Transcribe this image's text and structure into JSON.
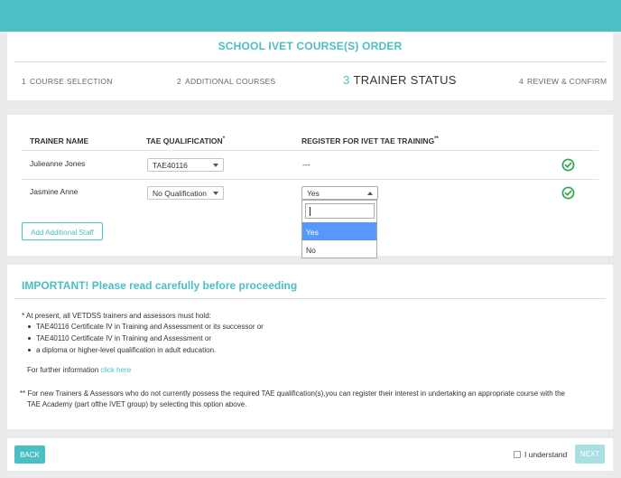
{
  "header": {
    "title": "SCHOOL IVET COURSE(S) ORDER"
  },
  "steps": [
    {
      "num": "1",
      "label": "COURSE SELECTION"
    },
    {
      "num": "2",
      "label": "ADDITIONAL COURSES"
    },
    {
      "num": "3",
      "label": "TRAINER STATUS"
    },
    {
      "num": "4",
      "label": "REVIEW & CONFIRM"
    }
  ],
  "active_step": 3,
  "table": {
    "headers": {
      "name": "TRAINER NAME",
      "tae": "TAE QUALIFICATION",
      "tae_mark": "*",
      "register": "REGISTER FOR IVET TAE TRAINING",
      "register_mark": "**"
    },
    "rows": [
      {
        "name": "Julieanne Jones",
        "qualification": "TAE40116",
        "register": "---"
      },
      {
        "name": "Jasmine Anne",
        "qualification": "No Qualification",
        "register": "Yes"
      }
    ],
    "add_staff_label": "Add Additional Staff"
  },
  "dropdown": {
    "search_value": "",
    "options": [
      "Yes",
      "No"
    ],
    "highlighted": "Yes"
  },
  "important": {
    "title": "IMPORTANT! Please read carefully before proceeding",
    "intro": "* At present, all VETDSS trainers and assessors must hold:",
    "bullets": [
      "TAE40116 Certificate IV in Training and Assessment or its successor or",
      "TAE40110 Certificate IV in Training and Assessment or",
      "a diploma or higher-level qualification in adult education."
    ],
    "further_info": "For further information",
    "click_here": "click here",
    "footnote_line1": "** For new Trainers & Assessors who do not currently possess the required TAE qualification(s),you can register their interest in undertaking an appropriate course with the",
    "footnote_line2": "TAE Academy (part ofthe IVET group) by selecting this option above."
  },
  "footer": {
    "back_label": "BACK",
    "understand_label": "I understand",
    "next_label": "NEXT"
  },
  "colors": {
    "accent": "#4bbfc4",
    "success": "#2aa84a",
    "highlight": "#5897fb"
  },
  "icons": {
    "status": "check-circle-icon"
  }
}
